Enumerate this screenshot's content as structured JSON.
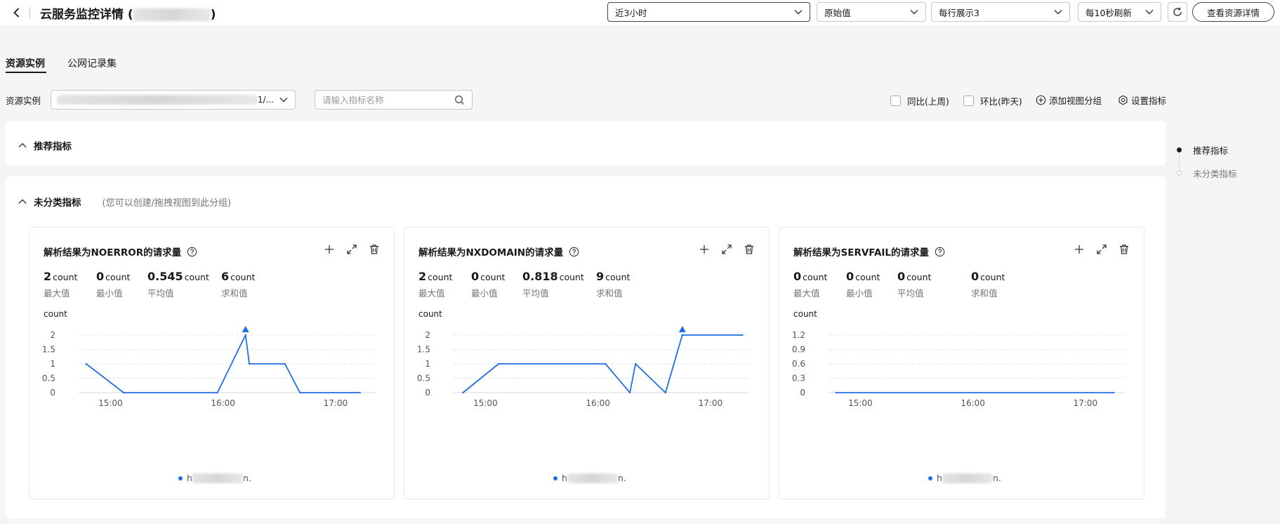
{
  "header": {
    "title": "云服务监控详情 (",
    "title_suffix": ")",
    "time_range": "近3小时",
    "value_type": "原始值",
    "per_row": "每行展示3",
    "refresh": "每10秒刷新",
    "detail_button": "查看资源详情"
  },
  "tabs": [
    {
      "label": "资源实例",
      "active": true
    },
    {
      "label": "公网记录集",
      "active": false
    }
  ],
  "filter": {
    "resource_label": "资源实例",
    "resource_count": "1/...",
    "search_placeholder": "请输入指标名称",
    "checkbox_yoy": "同比(上周)",
    "checkbox_mom": "环比(昨天)",
    "add_group": "添加视图分组",
    "settings": "设置指标"
  },
  "groups": {
    "recommended": "推荐指标",
    "uncategorized": "未分类指标",
    "uncategorized_hint": "(您可以创建/拖拽视图到此分组)"
  },
  "anchor_nav": [
    {
      "label": "推荐指标",
      "active": true
    },
    {
      "label": "未分类指标",
      "active": false
    }
  ],
  "colors": {
    "series": "#1f6fe5",
    "accent": "#191919"
  },
  "cards": [
    {
      "title": "解析结果为NOERROR的请求量",
      "unit_label": "count",
      "stats": [
        {
          "value": "2",
          "unit": "count",
          "label": "最大值"
        },
        {
          "value": "0",
          "unit": "count",
          "label": "最小值"
        },
        {
          "value": "0.545",
          "unit": "count",
          "label": "平均值"
        },
        {
          "value": "6",
          "unit": "count",
          "label": "求和值"
        }
      ],
      "legend_start": "h",
      "legend_end": "n."
    },
    {
      "title": "解析结果为NXDOMAIN的请求量",
      "unit_label": "count",
      "stats": [
        {
          "value": "2",
          "unit": "count",
          "label": "最大值"
        },
        {
          "value": "0",
          "unit": "count",
          "label": "最小值"
        },
        {
          "value": "0.818",
          "unit": "count",
          "label": "平均值"
        },
        {
          "value": "9",
          "unit": "count",
          "label": "求和值"
        }
      ],
      "legend_start": "h",
      "legend_end": "n."
    },
    {
      "title": "解析结果为SERVFAIL的请求量",
      "unit_label": "count",
      "stats": [
        {
          "value": "0",
          "unit": "count",
          "label": "最大值"
        },
        {
          "value": "0",
          "unit": "count",
          "label": "最小值"
        },
        {
          "value": "0",
          "unit": "count",
          "label": "平均值"
        },
        {
          "value": "0",
          "unit": "count",
          "label": "求和值"
        }
      ],
      "legend_start": "h",
      "legend_end": "n."
    }
  ],
  "chart_data": [
    {
      "type": "line",
      "title": "解析结果为NOERROR的请求量",
      "ylabel": "count",
      "ylim": [
        0,
        2
      ],
      "yticks": [
        "0",
        "0.5",
        "1",
        "1.5",
        "2"
      ],
      "xticks": [
        "15:00",
        "16:00",
        "17:00"
      ],
      "xlim": [
        "14:43",
        "17:21"
      ],
      "x": [
        "14:47",
        "15:07",
        "15:57",
        "16:12",
        "16:14",
        "16:33",
        "16:41",
        "17:13"
      ],
      "values": [
        1,
        0,
        0,
        2,
        1,
        1,
        0,
        0
      ],
      "max_marker": "16:12"
    },
    {
      "type": "line",
      "title": "解析结果为NXDOMAIN的请求量",
      "ylabel": "count",
      "ylim": [
        0,
        2
      ],
      "yticks": [
        "0",
        "0.5",
        "1",
        "1.5",
        "2"
      ],
      "xticks": [
        "15:00",
        "16:00",
        "17:00"
      ],
      "xlim": [
        "14:43",
        "17:21"
      ],
      "x": [
        "14:48",
        "15:07",
        "16:04",
        "16:17",
        "16:20",
        "16:36",
        "16:45",
        "17:17"
      ],
      "values": [
        0,
        1,
        1,
        0,
        1,
        0,
        2,
        2
      ],
      "max_marker": "16:45"
    },
    {
      "type": "line",
      "title": "解析结果为SERVFAIL的请求量",
      "ylabel": "count",
      "ylim": [
        0,
        1.2
      ],
      "yticks": [
        "0",
        "0.3",
        "0.6",
        "0.9",
        "1.2"
      ],
      "xticks": [
        "15:00",
        "16:00",
        "17:00"
      ],
      "xlim": [
        "14:43",
        "17:21"
      ],
      "x": [
        "14:47",
        "17:15"
      ],
      "values": [
        0,
        0
      ],
      "max_marker": null
    }
  ]
}
